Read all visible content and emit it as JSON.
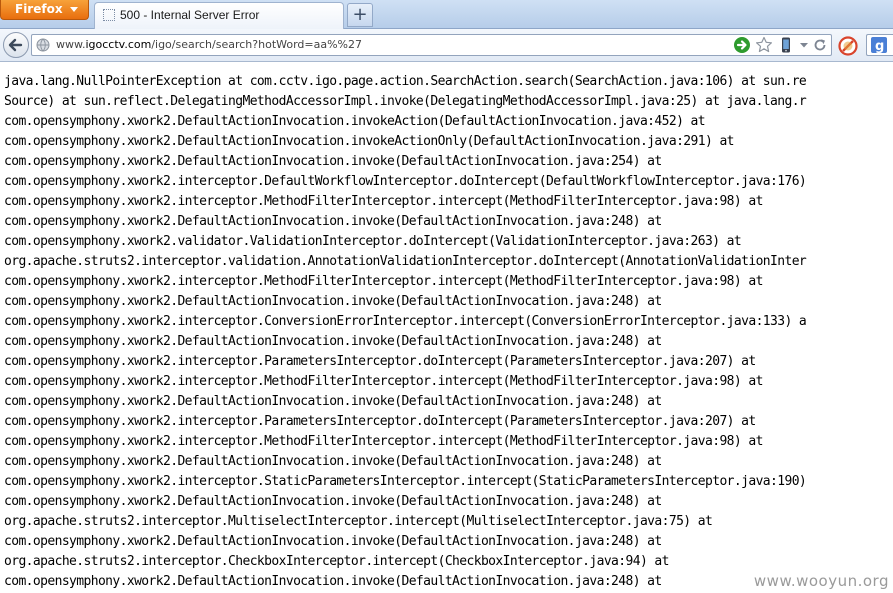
{
  "browser": {
    "menu_button_label": "Firefox",
    "tab_title": "500 - Internal Server Error",
    "new_tab_label": "+",
    "url_prefix": "www.",
    "url_host": "igocctv.com",
    "url_path": "/igo/search/search?hotWord=aa%%27",
    "icons": [
      "back-arrow-icon",
      "globe-icon",
      "go-arrow-icon",
      "bookmark-star-icon",
      "phone-icon",
      "dropdown-icon",
      "reload-icon",
      "stop-icon",
      "google-search-icon"
    ],
    "colors": {
      "menu_button": "#e8780f",
      "go_button": "#2e9b2e",
      "stop_button": "#d9442c",
      "tab_strip": "#c3d6ee"
    }
  },
  "error": {
    "lines": [
      "java.lang.NullPointerException at com.cctv.igo.page.action.SearchAction.search(SearchAction.java:106) at sun.re",
      "Source) at sun.reflect.DelegatingMethodAccessorImpl.invoke(DelegatingMethodAccessorImpl.java:25) at java.lang.r",
      "com.opensymphony.xwork2.DefaultActionInvocation.invokeAction(DefaultActionInvocation.java:452) at",
      "com.opensymphony.xwork2.DefaultActionInvocation.invokeActionOnly(DefaultActionInvocation.java:291) at",
      "com.opensymphony.xwork2.DefaultActionInvocation.invoke(DefaultActionInvocation.java:254) at",
      "com.opensymphony.xwork2.interceptor.DefaultWorkflowInterceptor.doIntercept(DefaultWorkflowInterceptor.java:176)",
      "com.opensymphony.xwork2.interceptor.MethodFilterInterceptor.intercept(MethodFilterInterceptor.java:98) at",
      "com.opensymphony.xwork2.DefaultActionInvocation.invoke(DefaultActionInvocation.java:248) at",
      "com.opensymphony.xwork2.validator.ValidationInterceptor.doIntercept(ValidationInterceptor.java:263) at",
      "org.apache.struts2.interceptor.validation.AnnotationValidationInterceptor.doIntercept(AnnotationValidationInter",
      "com.opensymphony.xwork2.interceptor.MethodFilterInterceptor.intercept(MethodFilterInterceptor.java:98) at",
      "com.opensymphony.xwork2.DefaultActionInvocation.invoke(DefaultActionInvocation.java:248) at",
      "com.opensymphony.xwork2.interceptor.ConversionErrorInterceptor.intercept(ConversionErrorInterceptor.java:133) a",
      "com.opensymphony.xwork2.DefaultActionInvocation.invoke(DefaultActionInvocation.java:248) at",
      "com.opensymphony.xwork2.interceptor.ParametersInterceptor.doIntercept(ParametersInterceptor.java:207) at",
      "com.opensymphony.xwork2.interceptor.MethodFilterInterceptor.intercept(MethodFilterInterceptor.java:98) at",
      "com.opensymphony.xwork2.DefaultActionInvocation.invoke(DefaultActionInvocation.java:248) at",
      "com.opensymphony.xwork2.interceptor.ParametersInterceptor.doIntercept(ParametersInterceptor.java:207) at",
      "com.opensymphony.xwork2.interceptor.MethodFilterInterceptor.intercept(MethodFilterInterceptor.java:98) at",
      "com.opensymphony.xwork2.DefaultActionInvocation.invoke(DefaultActionInvocation.java:248) at",
      "com.opensymphony.xwork2.interceptor.StaticParametersInterceptor.intercept(StaticParametersInterceptor.java:190)",
      "com.opensymphony.xwork2.DefaultActionInvocation.invoke(DefaultActionInvocation.java:248) at",
      "org.apache.struts2.interceptor.MultiselectInterceptor.intercept(MultiselectInterceptor.java:75) at",
      "com.opensymphony.xwork2.DefaultActionInvocation.invoke(DefaultActionInvocation.java:248) at",
      "org.apache.struts2.interceptor.CheckboxInterceptor.intercept(CheckboxInterceptor.java:94) at",
      "com.opensymphony.xwork2.DefaultActionInvocation.invoke(DefaultActionInvocation.java:248) at"
    ]
  },
  "watermark": "www.wooyun.org"
}
